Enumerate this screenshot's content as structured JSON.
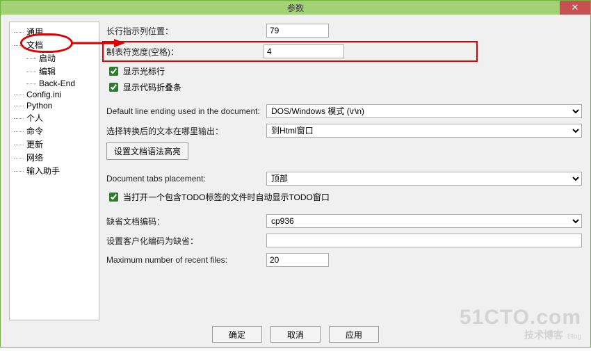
{
  "window": {
    "title": "参数"
  },
  "tree": {
    "items": [
      {
        "label": "通用"
      },
      {
        "label": "文档",
        "selected": true
      },
      {
        "label": "启动"
      },
      {
        "label": "编辑"
      },
      {
        "label": "Back-End"
      },
      {
        "label": "Config.ini"
      },
      {
        "label": "Python"
      },
      {
        "label": "个人"
      },
      {
        "label": "命令"
      },
      {
        "label": "更新"
      },
      {
        "label": "网络"
      },
      {
        "label": "输入助手"
      }
    ]
  },
  "form": {
    "long_line_label": "长行指示列位置：",
    "long_line_value": "79",
    "tab_width_label": "制表符宽度(空格)：",
    "tab_width_value": "4",
    "show_cursor_row": "显示光标行",
    "show_fold_bar": "显示代码折叠条",
    "line_ending_label": "Default line ending used in the document:",
    "line_ending_value": "DOS/Windows 模式 (\\r\\n)",
    "output_target_label": "选择转换后的文本在哪里输出：",
    "output_target_value": "到Html窗口",
    "syntax_hl_btn": "设置文档语法高亮",
    "tabs_placement_label": "Document tabs placement:",
    "tabs_placement_value": "顶部",
    "auto_todo": "当打开一个包含TODO标签的文件时自动显示TODO窗口",
    "default_encoding_label": "缺省文档编码：",
    "default_encoding_value": "cp936",
    "custom_encoding_label": "设置客户化编码为缺省：",
    "custom_encoding_value": "",
    "recent_files_label": "Maximum number of recent files:",
    "recent_files_value": "20"
  },
  "buttons": {
    "ok": "确定",
    "cancel": "取消",
    "apply": "应用"
  },
  "watermark": {
    "big": "51CTO.com",
    "sm": "技术博客",
    "tiny": "Blog"
  }
}
